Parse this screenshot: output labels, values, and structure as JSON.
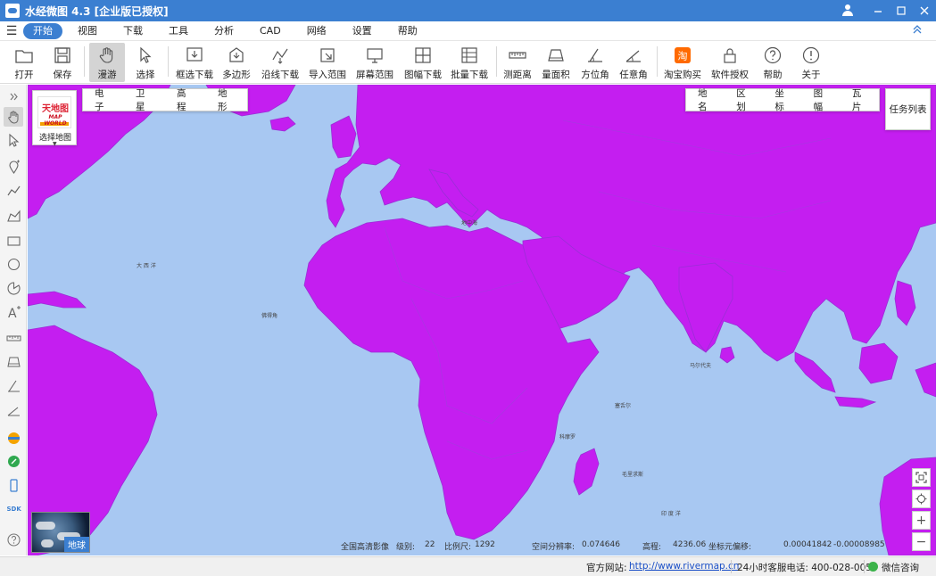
{
  "window": {
    "title": "水经微图 4.3 [企业版已授权]"
  },
  "menu": {
    "items": [
      "开始",
      "视图",
      "下载",
      "工具",
      "分析",
      "CAD",
      "网络",
      "设置",
      "帮助"
    ],
    "active": "开始"
  },
  "toolbar": {
    "open": "打开",
    "save": "保存",
    "pan": "漫游",
    "select": "选择",
    "frame_download": "框选下载",
    "polygon": "多边形",
    "line_download": "沿线下载",
    "import_range": "导入范围",
    "screen_range": "屏幕范围",
    "sheet_download": "图幅下载",
    "batch_download": "批量下载",
    "measure_distance": "测距离",
    "measure_area": "量面积",
    "azimuth": "方位角",
    "any_angle": "任意角",
    "taobao": "淘宝购买",
    "license": "软件授权",
    "help": "帮助",
    "about": "关于"
  },
  "map_source": {
    "logo_cn": "天地图",
    "logo_en": "MAP WORLD",
    "label": "选择地图"
  },
  "basemap_tabs": [
    "电子",
    "卫星",
    "高程",
    "地形"
  ],
  "layer_tabs": [
    "地名",
    "区划",
    "坐标",
    "图幅",
    "瓦片"
  ],
  "task_list": "任务列表",
  "globe_label": "地球",
  "map_status": {
    "imagery": "全国高清影像",
    "level_label": "级别:",
    "level": "22",
    "scale_label": "比例尺:",
    "scale": "1292",
    "resolution_label": "空间分辨率:",
    "resolution": "0.074646",
    "elevation_label": "高程:",
    "elevation": "4236.06",
    "coord_label": "坐标元偏移:",
    "coord_x": "0.00041842",
    "coord_y": "-0.00008985"
  },
  "status_bar": {
    "website_label": "官方网站:",
    "website": "http://www.rivermap.cn",
    "hotline": "24小时客服电话: 400-028-0050",
    "wechat": "微信咨询"
  },
  "colors": {
    "title_bar": "#3b7fd1",
    "land": "#c41ef0",
    "ocean": "#a8c8f2",
    "border": "#9a2fd6"
  }
}
